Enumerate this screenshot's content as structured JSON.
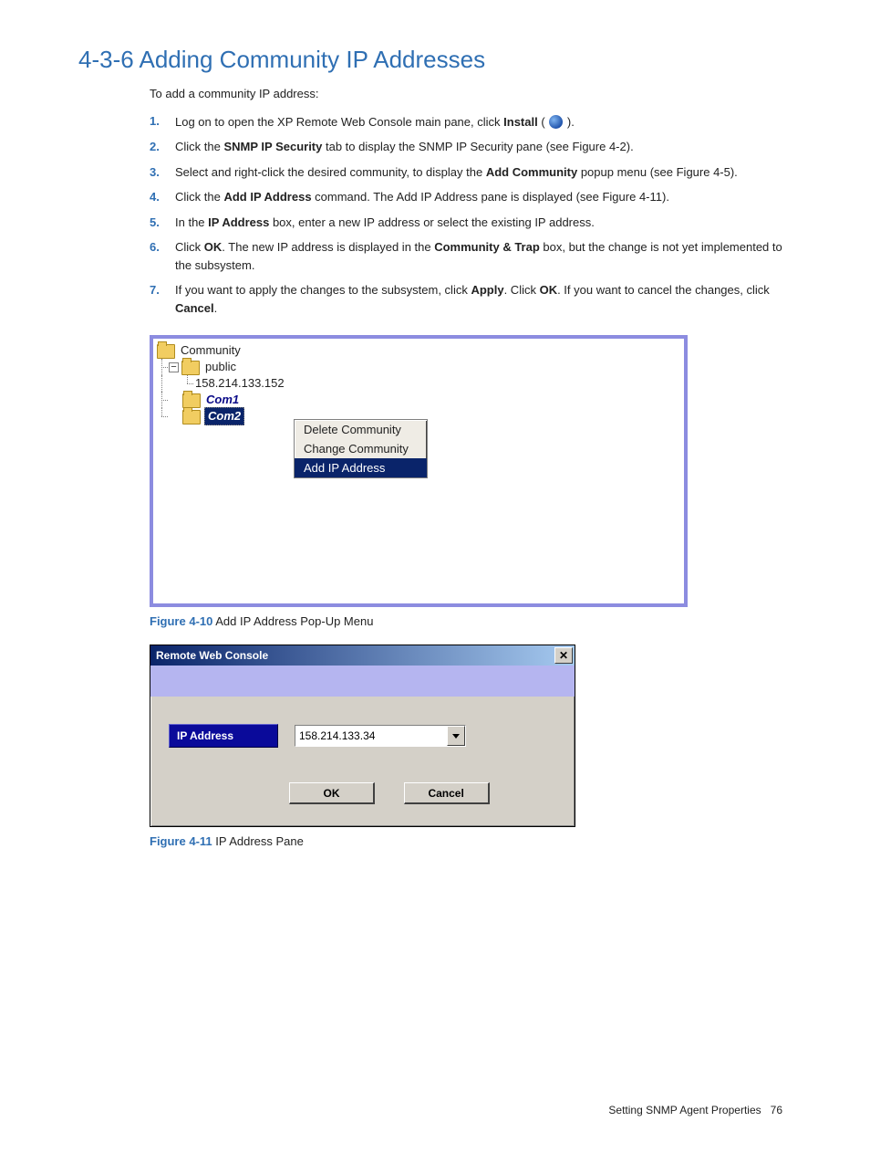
{
  "heading": "4-3-6 Adding Community IP Addresses",
  "intro": "To add a community IP address:",
  "steps": {
    "s1a": "Log on to open the XP Remote Web Console main pane, click ",
    "s1b": "Install",
    "s1c": " ( ",
    "s1d": " ).",
    "s2a": "Click the ",
    "s2b": "SNMP IP Security",
    "s2c": " tab to display the SNMP IP Security pane (see Figure 4-2).",
    "s3a": "Select and right-click the desired community, to display the ",
    "s3b": "Add Community",
    "s3c": " popup menu (see Figure 4-5).",
    "s4a": "Click the ",
    "s4b": "Add IP Address",
    "s4c": " command. The Add IP Address pane is displayed (see Figure 4-11).",
    "s5a": "In the ",
    "s5b": "IP Address",
    "s5c": " box, enter a new IP address or select the existing IP address.",
    "s6a": "Click ",
    "s6b": "OK",
    "s6c": ". The new IP address is displayed in the ",
    "s6d": "Community & Trap",
    "s6e": " box, but the change is not yet implemented to the subsystem.",
    "s7a": "If you want to apply the changes to the subsystem, click ",
    "s7b": "Apply",
    "s7c": ". Click ",
    "s7d": "OK",
    "s7e": ". If you want to cancel the changes, click ",
    "s7f": "Cancel",
    "s7g": "."
  },
  "tree": {
    "root": "Community",
    "public": "public",
    "ip": "158.214.133.152",
    "com1": "Com1",
    "com2": "Com2"
  },
  "context_menu": {
    "delete": "Delete Community",
    "change": "Change Community",
    "add_ip": "Add IP  Address"
  },
  "fig10": {
    "num": "Figure 4-10",
    "cap": " Add IP Address Pop-Up Menu"
  },
  "dialog": {
    "title": "Remote Web Console",
    "field_label": "IP Address",
    "ip_value": "158.214.133.34",
    "ok": "OK",
    "cancel": "Cancel"
  },
  "fig11": {
    "num": "Figure 4-11",
    "cap": " IP Address Pane"
  },
  "footer": {
    "section": "Setting SNMP Agent Properties",
    "page": "76"
  }
}
